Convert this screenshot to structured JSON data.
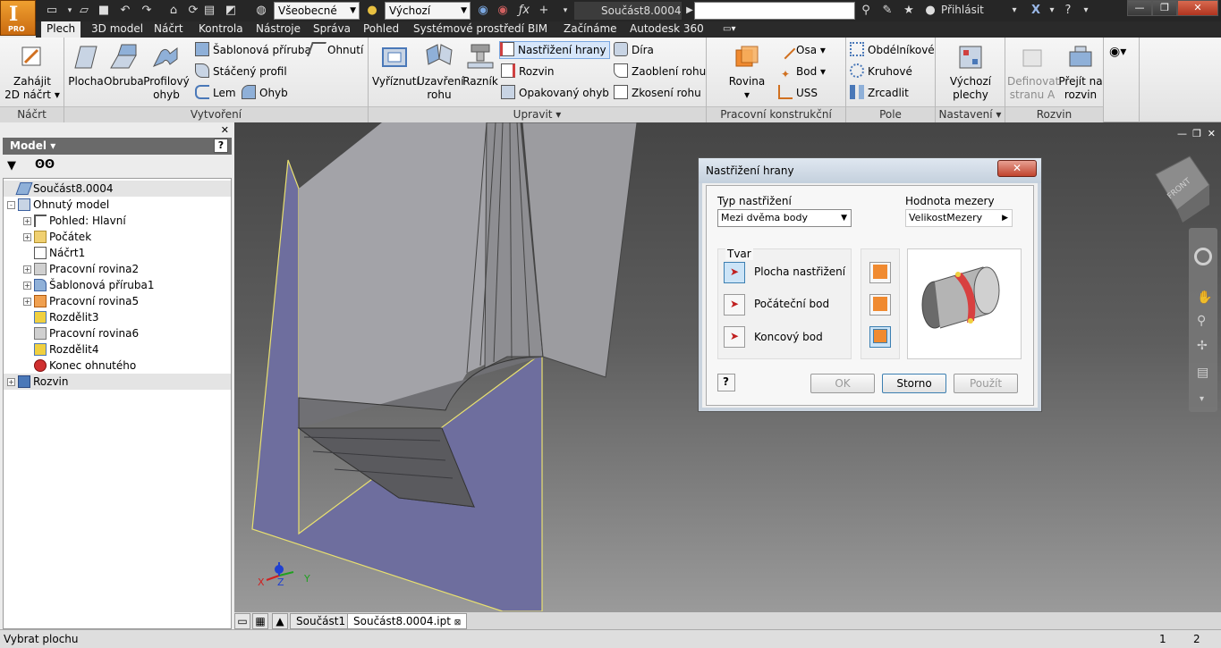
{
  "titlebar": {
    "style_dropdown": "Všeobecné",
    "appearance_dropdown": "Výchozí",
    "document_title": "Součást8.0004",
    "login_label": "Přihlásit",
    "app_badge": "PRO"
  },
  "tabs": [
    "Plech",
    "3D model",
    "Náčrt",
    "Kontrola",
    "Nástroje",
    "Správa",
    "Pohled",
    "Systémové prostředí",
    "BIM",
    "Začínáme",
    "Autodesk 360"
  ],
  "ribbon": {
    "panels": {
      "nacrt": "Náčrt",
      "vytvoreni": "Vytvoření",
      "upravit": "Upravit",
      "pracovni": "Pracovní konstrukční prvky",
      "pole": "Pole",
      "nastaveni": "Nastavení",
      "rozvin": "Rozvin"
    },
    "start_sketch": [
      "Zahájit",
      "2D náčrt"
    ],
    "plocha": "Plocha",
    "obruba": "Obruba",
    "profilovy_ohyb": [
      "Profilový",
      "ohyb"
    ],
    "sablonova_priruba": "Šablonová příruba",
    "staceny_profil": "Stáčený profil",
    "lem": "Lem",
    "ohnuti": "Ohnutí",
    "ohyb": "Ohyb",
    "vyriznuti": "Vyříznutí",
    "uzavreni_rohu": [
      "Uzavření",
      "rohu"
    ],
    "raznik": "Razník",
    "nastrizeni_hrany": "Nastřižení hrany",
    "rozvin_small": "Rozvin",
    "opakovany_ohyb": "Opakovaný ohyb",
    "dira": "Díra",
    "zaobleni_rohu": "Zaoblení rohu",
    "zkoseni_rohu": "Zkosení rohu",
    "rovina": "Rovina",
    "osa": "Osa",
    "bod": "Bod",
    "uss": "USS",
    "obdelnikove": "Obdélníkové",
    "kruhove": "Kruhové",
    "zrcadlit": "Zrcadlit",
    "vychozi_plechy": [
      "Výchozí",
      "plechy"
    ],
    "definovat_stranu": [
      "Definovat",
      "stranu A"
    ],
    "prejit_na_rozvin": [
      "Přejít na",
      "rozvin"
    ]
  },
  "browser": {
    "title": "Model",
    "nodes": [
      {
        "label": "Součást8.0004",
        "level": 0,
        "expander": "",
        "icon": "part-icon"
      },
      {
        "label": "Ohnutý model",
        "level": 0,
        "expander": "-",
        "icon": "folded-model-icon"
      },
      {
        "label": "Pohled: Hlavní",
        "level": 1,
        "expander": "+",
        "icon": "view-icon"
      },
      {
        "label": "Počátek",
        "level": 1,
        "expander": "+",
        "icon": "folder-icon"
      },
      {
        "label": "Náčrt1",
        "level": 1,
        "expander": "",
        "icon": "sketch-icon"
      },
      {
        "label": "Pracovní rovina2",
        "level": 1,
        "expander": "+",
        "icon": "workplane-icon"
      },
      {
        "label": "Šablonová příruba1",
        "level": 1,
        "expander": "+",
        "icon": "contour-flange-icon"
      },
      {
        "label": "Pracovní rovina5",
        "level": 1,
        "expander": "+",
        "icon": "workplane-orange-icon"
      },
      {
        "label": "Rozdělit3",
        "level": 1,
        "expander": "",
        "icon": "split-icon"
      },
      {
        "label": "Pracovní rovina6",
        "level": 1,
        "expander": "",
        "icon": "workplane-icon"
      },
      {
        "label": "Rozdělit4",
        "level": 1,
        "expander": "",
        "icon": "split-icon"
      },
      {
        "label": "Konec ohnutého",
        "level": 1,
        "expander": "",
        "icon": "end-of-folded-icon"
      },
      {
        "label": "Rozvin",
        "level": 0,
        "expander": "+",
        "icon": "flat-pattern-icon"
      }
    ]
  },
  "dialog": {
    "title": "Nastřižení hrany",
    "rip_type_label": "Typ nastřižení",
    "rip_type_value": "Mezi dvěma body",
    "gap_label": "Hodnota mezery",
    "gap_value": "VelikostMezery",
    "shape_label": "Tvar",
    "shape_items": [
      "Plocha nastřižení",
      "Počáteční bod",
      "Koncový bod"
    ],
    "ok": "OK",
    "cancel": "Storno",
    "apply": "Použít"
  },
  "doc_tabs": [
    "Součást1",
    "Součást8.0004.ipt"
  ],
  "status": {
    "text": "Vybrat plochu",
    "count1": "1",
    "count2": "2"
  },
  "viewcube_label": "FRONT",
  "colors": {
    "ribbon_sel": "#d6e6fa",
    "plane": "#6f6fa0",
    "plane_edge": "#e8e070",
    "sheet": "#a8a8a8"
  }
}
